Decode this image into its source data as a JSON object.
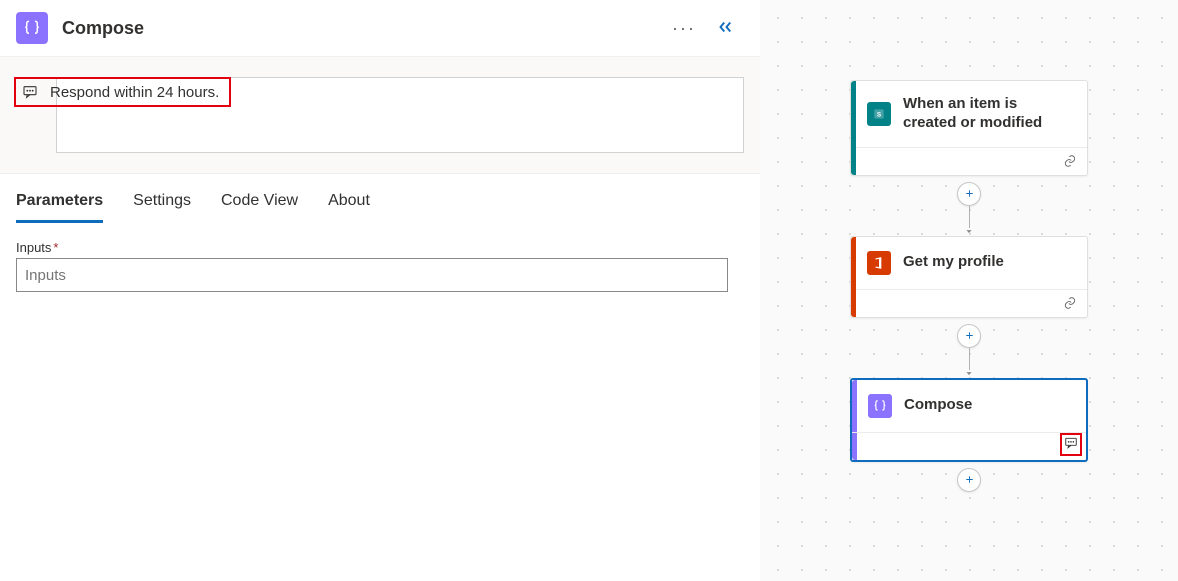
{
  "header": {
    "title": "Compose",
    "icon": "braces-icon"
  },
  "note": {
    "text": "Respond within 24 hours."
  },
  "tabs": {
    "items": [
      {
        "label": "Parameters"
      },
      {
        "label": "Settings"
      },
      {
        "label": "Code View"
      },
      {
        "label": "About"
      }
    ],
    "active_index": 0
  },
  "parameters": {
    "inputs_label": "Inputs",
    "inputs_value": "",
    "inputs_placeholder": "Inputs"
  },
  "canvas": {
    "cards": [
      {
        "title": "When an item is created or modified",
        "accent": "#038387",
        "icon": "sharepoint-icon",
        "has_link_footer": true
      },
      {
        "title": "Get my profile",
        "accent": "#d83b01",
        "icon": "office-icon",
        "has_link_footer": true
      },
      {
        "title": "Compose",
        "accent": "#8c73ff",
        "icon": "braces-icon",
        "selected": true,
        "has_note_footer": true
      }
    ]
  }
}
